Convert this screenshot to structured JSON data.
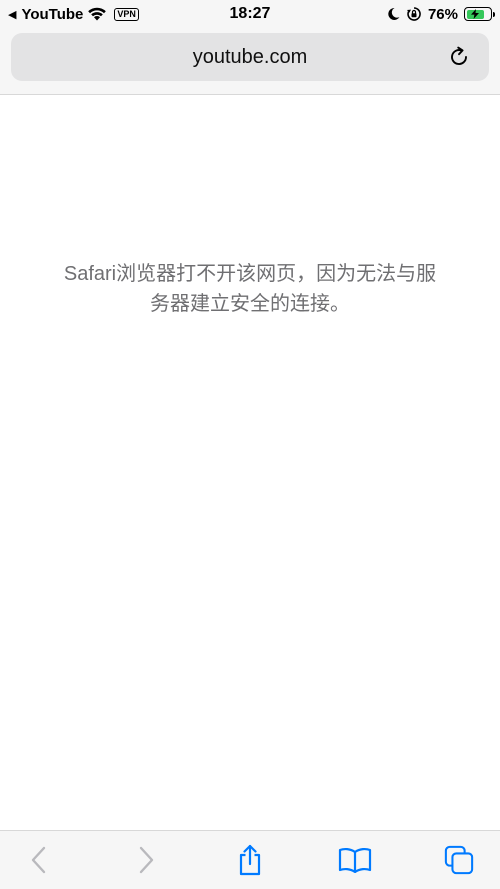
{
  "status_bar": {
    "back_app": "YouTube",
    "vpn": "VPN",
    "time": "18:27",
    "battery_percent": "76%",
    "battery_level": 0.76
  },
  "address_bar": {
    "url": "youtube.com"
  },
  "page": {
    "error_message": "Safari浏览器打不开该网页，因为无法与服务器建立安全的连接。"
  },
  "colors": {
    "accent": "#007aff",
    "disabled": "#b9b9bd",
    "message": "#6f6f72"
  },
  "icons": {
    "back": "chevron-left-icon",
    "forward": "chevron-right-icon",
    "share": "share-icon",
    "bookmarks": "book-icon",
    "tabs": "tabs-icon",
    "reload": "reload-icon"
  }
}
